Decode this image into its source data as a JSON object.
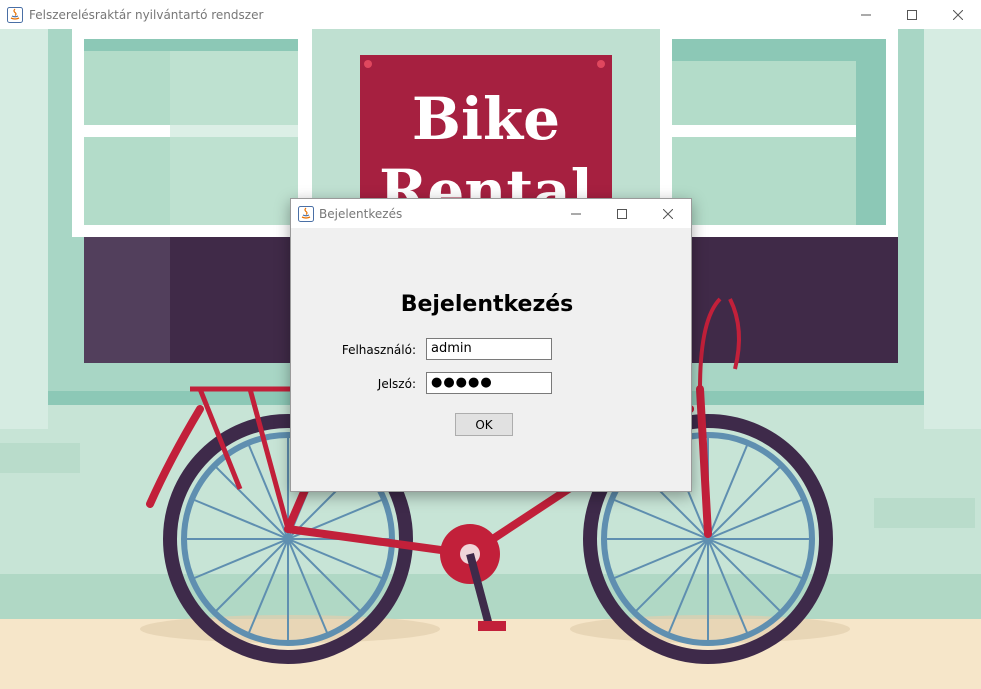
{
  "main_window": {
    "title": "Felszerelésraktár nyilvántartó rendszer"
  },
  "background": {
    "sign_line1": "Bike",
    "sign_line2": "Rental"
  },
  "dialog": {
    "title": "Bejelentkezés",
    "heading": "Bejelentkezés",
    "username_label": "Felhasználó:",
    "username_value": "admin",
    "password_label": "Jelszó:",
    "password_value": "●●●●●",
    "ok_label": "OK"
  },
  "colors": {
    "wall_mint": "#c7e4d6",
    "window_frame": "#8cc8b6",
    "sign_red": "#a62040",
    "awning_dark": "#402a48",
    "bike_frame": "#c2203a",
    "bike_wheel": "#3e2a4a",
    "floor": "#f6e6c9"
  }
}
